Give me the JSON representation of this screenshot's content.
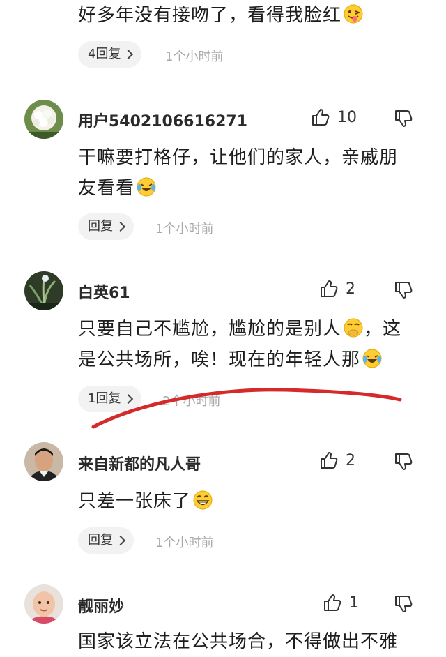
{
  "comments": [
    {
      "text": "好多年没有接吻了，看得我脸红",
      "emoji": "tongue-emoji",
      "reply_label": "4回复",
      "time": "1个小时前"
    },
    {
      "username": "用户5402106616271",
      "likes": "10",
      "text_line1": "干嘛要打格仔，让他们的家人，亲戚朋",
      "text_line2": "友看看",
      "emoji": "laugh-cry-emoji",
      "reply_label": "回复",
      "time": "1个小时前"
    },
    {
      "username": "白英61",
      "likes": "2",
      "text_line1a": "只要自己不尴尬，尴尬的是别人",
      "text_line1b": "，这",
      "text_line2": "是公共场所，唉！现在的年轻人那",
      "reply_label": "1回复",
      "time": "2个小时前"
    },
    {
      "username": "来自新都的凡人哥",
      "likes": "2",
      "text": "只差一张床了",
      "emoji": "grin-emoji",
      "reply_label": "回复",
      "time": "1个小时前"
    },
    {
      "username": "靓丽妙",
      "likes": "1",
      "text": "国家该立法在公共场合，不得做出不雅"
    }
  ],
  "annotation": {
    "stroke_color": "#d42a2a"
  }
}
